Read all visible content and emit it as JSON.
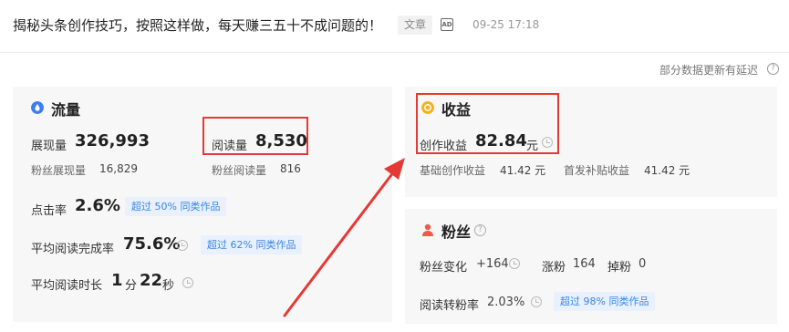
{
  "header": {
    "title": "揭秘头条创作技巧，按照这样做，每天赚三五十不成问题的！",
    "type_tag": "文章",
    "ad_label": "AD",
    "publish_time": "09-25 17:18"
  },
  "delay_note": {
    "text": "部分数据更新有延迟",
    "help": "?"
  },
  "traffic": {
    "title": "流量",
    "impressions_label": "展现量",
    "impressions_value": "326,993",
    "reads_label": "阅读量",
    "reads_value": "8,530",
    "fan_impressions_label": "粉丝展现量",
    "fan_impressions_value": "16,829",
    "fan_reads_label": "粉丝阅读量",
    "fan_reads_value": "816",
    "ctr_label": "点击率",
    "ctr_value": "2.6%",
    "ctr_badge": "超过 50% 同类作品",
    "completion_label": "平均阅读完成率",
    "completion_value": "75.6%",
    "completion_badge": "超过 62% 同类作品",
    "duration_label": "平均阅读时长",
    "duration_min": "1",
    "duration_min_unit": "分",
    "duration_sec": "22",
    "duration_sec_unit": "秒"
  },
  "revenue": {
    "title": "收益",
    "creation_label": "创作收益",
    "creation_value": "82.84",
    "creation_unit": "元",
    "base_label": "基础创作收益",
    "base_value": "41.42 元",
    "first_label": "首发补贴收益",
    "first_value": "41.42 元"
  },
  "fans": {
    "title": "粉丝",
    "change_label": "粉丝变化",
    "change_value": "+164",
    "gain_label": "涨粉",
    "gain_value": "164",
    "loss_label": "掉粉",
    "loss_value": "0",
    "conversion_label": "阅读转粉率",
    "conversion_value": "2.03%",
    "conversion_badge": "超过 98% 同类作品"
  },
  "colors": {
    "highlight": "#e53935",
    "badge_text": "#3b86e6",
    "badge_bg": "#e8f1fd",
    "traffic_icon": "#3b7ef0",
    "revenue_icon": "#f3b21e",
    "fans_icon": "#f05a4a"
  }
}
